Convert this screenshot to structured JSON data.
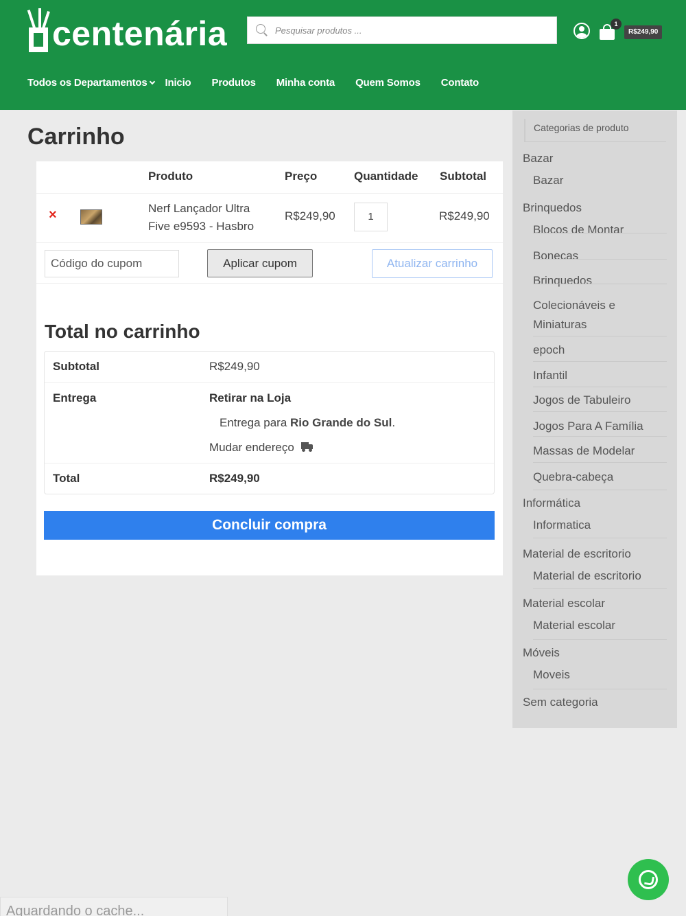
{
  "header": {
    "logo_text": "centenária",
    "search_placeholder": "Pesquisar produtos ...",
    "cart_count": "1",
    "cart_total": "R$249,90",
    "colors": {
      "brand": "#1a9145",
      "accent": "#2f80ed",
      "remove": "#e2231a"
    }
  },
  "nav": {
    "departments": "Todos os Departamentos",
    "items": [
      "Inicio",
      "Produtos",
      "Minha conta",
      "Quem Somos",
      "Contato"
    ]
  },
  "page": {
    "title": "Carrinho"
  },
  "cart": {
    "columns": {
      "product": "Produto",
      "price": "Preço",
      "quantity": "Quantidade",
      "subtotal": "Subtotal"
    },
    "items": [
      {
        "remove": "×",
        "name": "Nerf Lançador Ultra Five e9593 - Hasbro",
        "price": "R$249,90",
        "quantity": "1",
        "subtotal": "R$249,90"
      }
    ],
    "coupon_placeholder": "Código do cupom",
    "apply_label": "Aplicar cupom",
    "update_label": "Atualizar carrinho"
  },
  "totals": {
    "title": "Total no carrinho",
    "subtotal_label": "Subtotal",
    "subtotal_value": "R$249,90",
    "shipping_label": "Entrega",
    "shipping_method": "Retirar na Loja",
    "shipping_dest_prefix": "Entrega para ",
    "shipping_dest_region": "Rio Grande do Sul",
    "shipping_dest_suffix": ".",
    "change_address": "Mudar endereço",
    "total_label": "Total",
    "total_value": "R$249,90",
    "checkout_label": "Concluir compra"
  },
  "sidebar": {
    "title": "Categorias de produto",
    "items": [
      {
        "label": "Bazar",
        "level": "parent"
      },
      {
        "label": "Bazar",
        "level": "child"
      },
      {
        "label": "Brinquedos",
        "level": "parent"
      },
      {
        "label": "Blocos de Montar",
        "level": "child"
      },
      {
        "label": "Bonecas",
        "level": "child"
      },
      {
        "label": "Brinquedos",
        "level": "child"
      },
      {
        "label": "Colecionáveis e Miniaturas",
        "level": "child"
      },
      {
        "label": "epoch",
        "level": "child"
      },
      {
        "label": "Infantil",
        "level": "child"
      },
      {
        "label": "Jogos de Tabuleiro",
        "level": "child"
      },
      {
        "label": "Jogos Para A Família",
        "level": "child"
      },
      {
        "label": "Massas de Modelar",
        "level": "child"
      },
      {
        "label": "Quebra-cabeça",
        "level": "child"
      },
      {
        "label": "Informática",
        "level": "parent"
      },
      {
        "label": "Informatica",
        "level": "child"
      },
      {
        "label": "Material de escritorio",
        "level": "parent"
      },
      {
        "label": "Material de escritorio",
        "level": "child"
      },
      {
        "label": "Material escolar",
        "level": "parent"
      },
      {
        "label": "Material escolar",
        "level": "child"
      },
      {
        "label": "Móveis",
        "level": "parent"
      },
      {
        "label": "Moveis",
        "level": "child"
      },
      {
        "label": "Sem categoria",
        "level": "parent"
      }
    ]
  },
  "status_bar": {
    "text": "Aguardando o cache..."
  },
  "icons": [
    "search-icon",
    "user-icon",
    "shopping-bag-icon",
    "chevron-down-icon",
    "remove-icon",
    "truck-icon",
    "whatsapp-icon"
  ]
}
